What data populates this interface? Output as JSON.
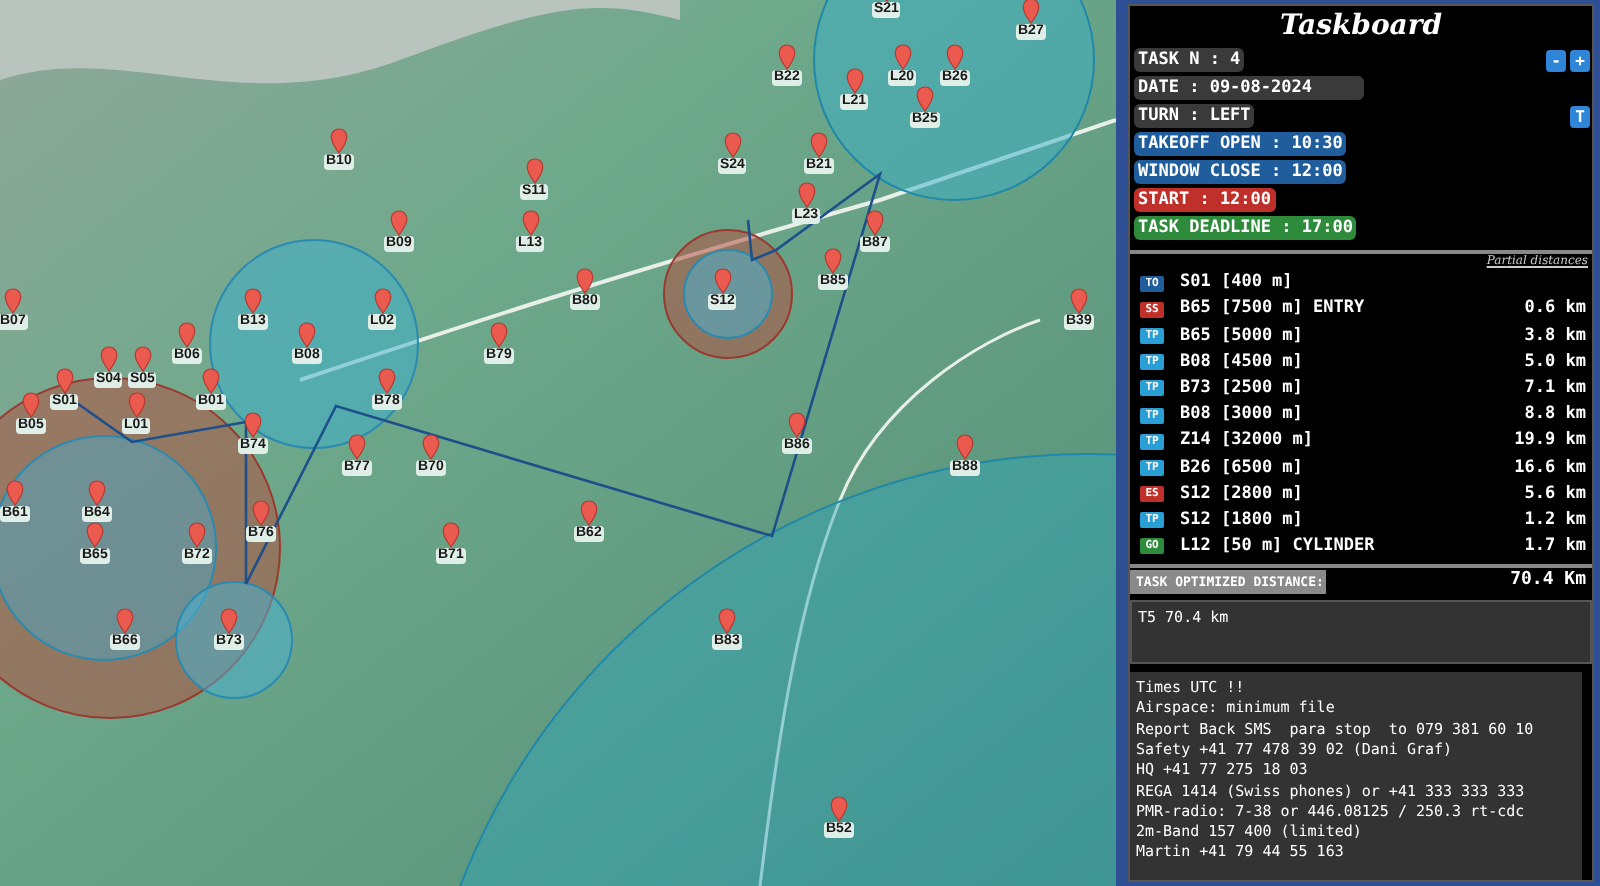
{
  "map": {
    "waypoints": [
      {
        "label": "S21"
      },
      {
        "label": "B27"
      },
      {
        "label": "B22"
      },
      {
        "label": "L20"
      },
      {
        "label": "B26"
      },
      {
        "label": "L21"
      },
      {
        "label": "B25"
      },
      {
        "label": "B10"
      },
      {
        "label": "S24"
      },
      {
        "label": "B21"
      },
      {
        "label": "S11"
      },
      {
        "label": "L23"
      },
      {
        "label": "B09"
      },
      {
        "label": "L13"
      },
      {
        "label": "B87"
      },
      {
        "label": "B85"
      },
      {
        "label": "B80"
      },
      {
        "label": "S12"
      },
      {
        "label": "B07"
      },
      {
        "label": "B13"
      },
      {
        "label": "L02"
      },
      {
        "label": "B39"
      },
      {
        "label": "B06"
      },
      {
        "label": "B08"
      },
      {
        "label": "B79"
      },
      {
        "label": "S04"
      },
      {
        "label": "S05"
      },
      {
        "label": "S01"
      },
      {
        "label": "B01"
      },
      {
        "label": "B78"
      },
      {
        "label": "B05"
      },
      {
        "label": "L01"
      },
      {
        "label": "B74"
      },
      {
        "label": "B86"
      },
      {
        "label": "B77"
      },
      {
        "label": "B70"
      },
      {
        "label": "B88"
      },
      {
        "label": "B61"
      },
      {
        "label": "B64"
      },
      {
        "label": "B76"
      },
      {
        "label": "B62"
      },
      {
        "label": "B65"
      },
      {
        "label": "B72"
      },
      {
        "label": "B71"
      },
      {
        "label": "B66"
      },
      {
        "label": "B73"
      },
      {
        "label": "B83"
      },
      {
        "label": "B52"
      }
    ]
  },
  "taskboard": {
    "title": "Taskboard",
    "info": [
      {
        "text": "TASK N : 4",
        "kind": "label",
        "color": "#3a3a3a",
        "buttons": [
          "-",
          "+"
        ]
      },
      {
        "text": "DATE : 09-08-2024",
        "kind": "field",
        "color": "#3a3a3a"
      },
      {
        "text": "TURN : LEFT",
        "kind": "label",
        "color": "#3a3a3a",
        "buttons": [
          "T"
        ]
      },
      {
        "text": "TAKEOFF OPEN : 10:30",
        "kind": "label",
        "color": "#1f5d9c"
      },
      {
        "text": "WINDOW CLOSE : 12:00",
        "kind": "label",
        "color": "#1f5d9c"
      },
      {
        "text": "START : 12:00",
        "kind": "label",
        "color": "#c0302b"
      },
      {
        "text": "TASK DEADLINE : 17:00",
        "kind": "label",
        "color": "#2e8b3b"
      }
    ],
    "partial_distances_label": "Partial distances",
    "turnpoints": [
      {
        "type": "TO",
        "color": "#1f5d9c",
        "name": "S01 [400 m]"
      },
      {
        "type": "SS",
        "color": "#c0302b",
        "name": "B65 [7500 m] ENTRY",
        "distance": "0.6 km"
      },
      {
        "type": "TP",
        "color": "#2a9fd6",
        "name": "B65 [5000 m]",
        "distance": "3.8 km"
      },
      {
        "type": "TP",
        "color": "#2a9fd6",
        "name": "B08 [4500 m]",
        "distance": "5.0 km"
      },
      {
        "type": "TP",
        "color": "#2a9fd6",
        "name": "B73 [2500 m]",
        "distance": "7.1 km"
      },
      {
        "type": "TP",
        "color": "#2a9fd6",
        "name": "B08 [3000 m]",
        "distance": "8.8 km"
      },
      {
        "type": "TP",
        "color": "#2a9fd6",
        "name": "Z14 [32000 m]",
        "distance": "19.9 km"
      },
      {
        "type": "TP",
        "color": "#2a9fd6",
        "name": "B26 [6500 m]",
        "distance": "16.6 km"
      },
      {
        "type": "ES",
        "color": "#c0302b",
        "name": "S12 [2800 m]",
        "distance": "5.6 km"
      },
      {
        "type": "TP",
        "color": "#2a9fd6",
        "name": "S12 [1800 m]",
        "distance": "1.2 km"
      },
      {
        "type": "GO",
        "color": "#2e8b3b",
        "name": "L12 [50 m] CYLINDER",
        "distance": "1.7 km"
      }
    ],
    "optimized_distance": {
      "label": "TASK OPTIMIZED DISTANCE:",
      "value": "70.4 Km"
    },
    "summary": "T5 70.4 km",
    "notes": [
      "Times UTC !!",
      "Airspace: minimum file",
      "Report Back SMS  para stop  to 079 381 60 10",
      "Safety +41 77 478 39 02 (Dani Graf)",
      "HQ +41 77 275 18 03",
      "REGA 1414 (Swiss phones) or +41 333 333 333",
      "PMR-radio: 7-38 or 446.08125 / 250.3 rt-cdc",
      "2m-Band 157 400 (limited)",
      "Martin +41 79 44 55 163"
    ]
  }
}
